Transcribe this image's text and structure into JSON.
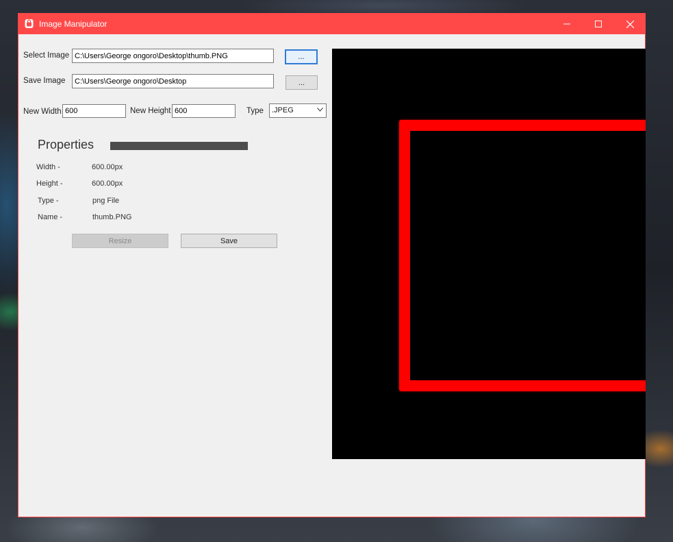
{
  "window": {
    "title": "Image Manipulator",
    "accent_color": "#ff4949"
  },
  "titlebar_icons": {
    "app": "lock-app-icon",
    "minimize": "minimize-icon",
    "maximize": "maximize-icon",
    "close": "close-icon"
  },
  "select_image": {
    "label": "Select Image",
    "value": "C:\\Users\\George ongoro\\Desktop\\thumb.PNG",
    "browse_label": "..."
  },
  "save_image": {
    "label": "Save Image",
    "value": "C:\\Users\\George ongoro\\Desktop",
    "browse_label": "..."
  },
  "size": {
    "width_label": "New Width",
    "width_value": "600",
    "height_label": "New Height",
    "height_value": "600"
  },
  "type": {
    "label": "Type",
    "selected": ".JPEG"
  },
  "properties": {
    "title": "Properties",
    "progress_fraction": 1.0,
    "items": [
      {
        "key": "Width -",
        "value": "600.00px"
      },
      {
        "key": "Height -",
        "value": "600.00px"
      },
      {
        "key": "Type -",
        "value": "png File"
      },
      {
        "key": "Name -",
        "value": "thumb.PNG"
      }
    ]
  },
  "actions": {
    "resize_label": "Resize",
    "save_label": "Save"
  },
  "preview": {
    "background": "#000000",
    "shape_color": "#ff0000"
  }
}
